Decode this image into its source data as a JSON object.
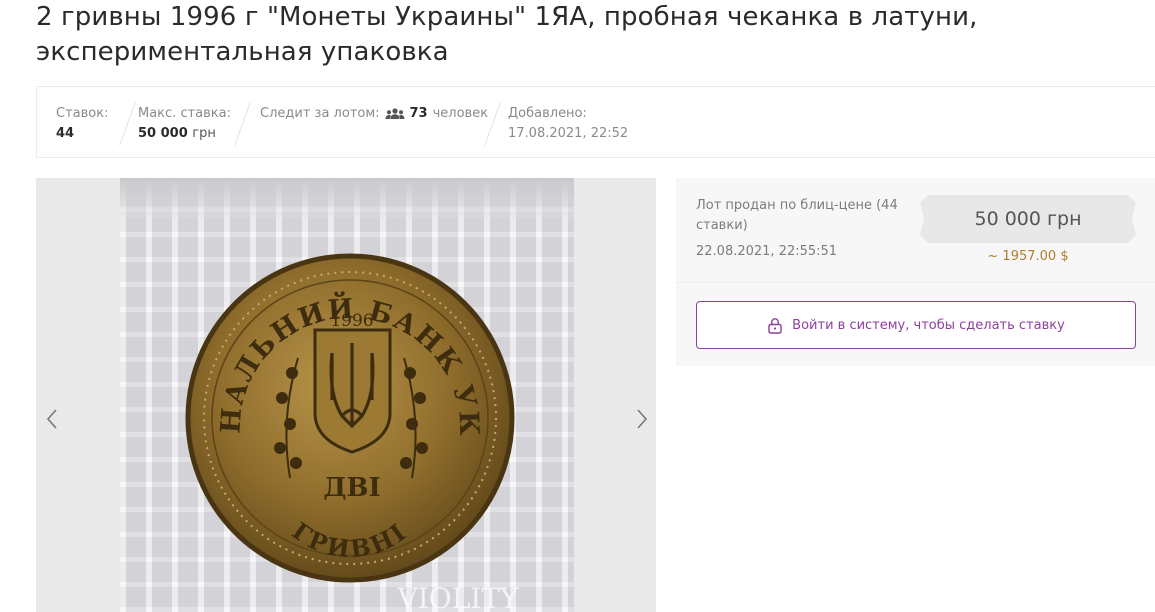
{
  "lot": {
    "title": "2 гривны 1996 г \"Монеты Украины\" 1ЯА, пробная чеканка в латуни, экспериментальная упаковка"
  },
  "stats": {
    "bids_label": "Ставок:",
    "bids_value": "44",
    "max_bid_label": "Макс. ставка:",
    "max_bid_value": "50 000",
    "max_bid_currency": "грн",
    "watchers_label": "Следит за лотом:",
    "watchers_icon": "users-icon",
    "watchers_count": "73",
    "watchers_unit": "человек",
    "added_label": "Добавлено:",
    "added_date": "17.08.2021, 22:52"
  },
  "gallery": {
    "prev_icon": "chevron-left-icon",
    "next_icon": "chevron-right-icon",
    "watermark": "VIOLITY",
    "coin": {
      "top_legend": "НАЦІОНАЛЬНИЙ БАНК УКРАЇНИ",
      "year": "1996",
      "denomination_line1": "ДВІ",
      "denomination_line2": "ГРИВНІ"
    }
  },
  "sale": {
    "status_text": "Лот продан по блиц-цене (44 ставки)",
    "sold_date": "22.08.2021, 22:55:51",
    "price": "50 000 грн",
    "price_usd": "~ 1957.00 $",
    "login_icon": "lock-icon",
    "login_button": "Войти в систему, чтобы сделать ставку"
  },
  "colors": {
    "accent": "#8e3e9e",
    "usd": "#b07d2b",
    "coin_brass": "#8a6a2a"
  }
}
